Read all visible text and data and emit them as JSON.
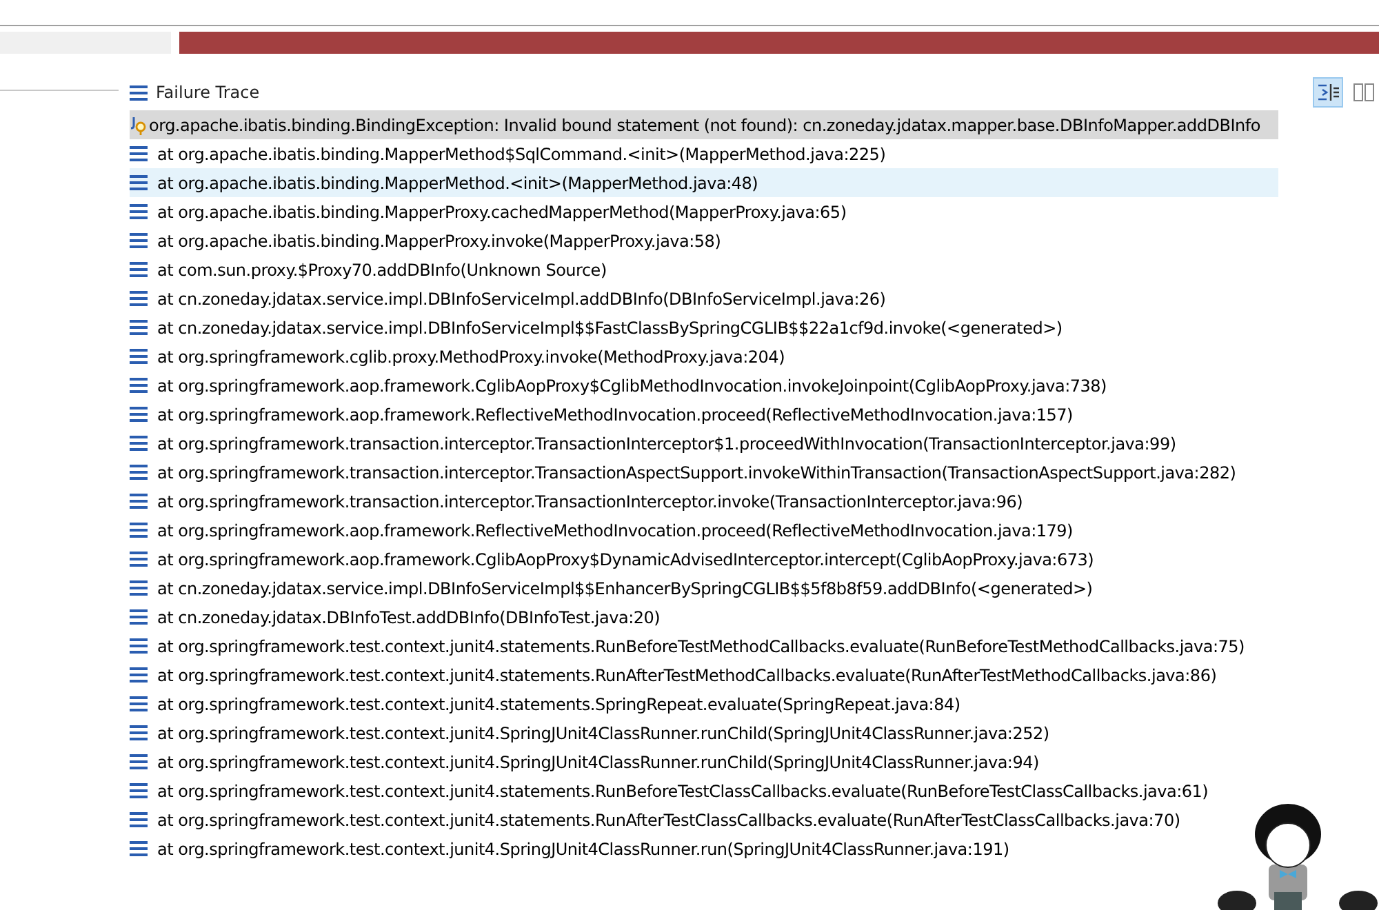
{
  "panel": {
    "title": "Failure Trace",
    "progress": {
      "level": 1,
      "failed": true
    }
  },
  "toolbar": [
    {
      "kind": "filter",
      "selected": true
    },
    {
      "kind": "compare",
      "selected": false
    }
  ],
  "trace": [
    {
      "kind": "exception",
      "text": "org.apache.ibatis.binding.BindingException: Invalid bound statement (not found): cn.zoneday.jdatax.mapper.base.DBInfoMapper.addDBInfo",
      "selected": true,
      "hovered": false
    },
    {
      "kind": "frame",
      "text": "at org.apache.ibatis.binding.MapperMethod$SqlCommand.<init>(MapperMethod.java:225)",
      "selected": false,
      "hovered": false
    },
    {
      "kind": "frame",
      "text": "at org.apache.ibatis.binding.MapperMethod.<init>(MapperMethod.java:48)",
      "selected": false,
      "hovered": true
    },
    {
      "kind": "frame",
      "text": "at org.apache.ibatis.binding.MapperProxy.cachedMapperMethod(MapperProxy.java:65)",
      "selected": false,
      "hovered": false
    },
    {
      "kind": "frame",
      "text": "at org.apache.ibatis.binding.MapperProxy.invoke(MapperProxy.java:58)",
      "selected": false,
      "hovered": false
    },
    {
      "kind": "frame",
      "text": "at com.sun.proxy.$Proxy70.addDBInfo(Unknown Source)",
      "selected": false,
      "hovered": false
    },
    {
      "kind": "frame",
      "text": "at cn.zoneday.jdatax.service.impl.DBInfoServiceImpl.addDBInfo(DBInfoServiceImpl.java:26)",
      "selected": false,
      "hovered": false
    },
    {
      "kind": "frame",
      "text": "at cn.zoneday.jdatax.service.impl.DBInfoServiceImpl$$FastClassBySpringCGLIB$$22a1cf9d.invoke(<generated>)",
      "selected": false,
      "hovered": false
    },
    {
      "kind": "frame",
      "text": "at org.springframework.cglib.proxy.MethodProxy.invoke(MethodProxy.java:204)",
      "selected": false,
      "hovered": false
    },
    {
      "kind": "frame",
      "text": "at org.springframework.aop.framework.CglibAopProxy$CglibMethodInvocation.invokeJoinpoint(CglibAopProxy.java:738)",
      "selected": false,
      "hovered": false
    },
    {
      "kind": "frame",
      "text": "at org.springframework.aop.framework.ReflectiveMethodInvocation.proceed(ReflectiveMethodInvocation.java:157)",
      "selected": false,
      "hovered": false
    },
    {
      "kind": "frame",
      "text": "at org.springframework.transaction.interceptor.TransactionInterceptor$1.proceedWithInvocation(TransactionInterceptor.java:99)",
      "selected": false,
      "hovered": false
    },
    {
      "kind": "frame",
      "text": "at org.springframework.transaction.interceptor.TransactionAspectSupport.invokeWithinTransaction(TransactionAspectSupport.java:282)",
      "selected": false,
      "hovered": false
    },
    {
      "kind": "frame",
      "text": "at org.springframework.transaction.interceptor.TransactionInterceptor.invoke(TransactionInterceptor.java:96)",
      "selected": false,
      "hovered": false
    },
    {
      "kind": "frame",
      "text": "at org.springframework.aop.framework.ReflectiveMethodInvocation.proceed(ReflectiveMethodInvocation.java:179)",
      "selected": false,
      "hovered": false
    },
    {
      "kind": "frame",
      "text": "at org.springframework.aop.framework.CglibAopProxy$DynamicAdvisedInterceptor.intercept(CglibAopProxy.java:673)",
      "selected": false,
      "hovered": false
    },
    {
      "kind": "frame",
      "text": "at cn.zoneday.jdatax.service.impl.DBInfoServiceImpl$$EnhancerBySpringCGLIB$$5f8b8f59.addDBInfo(<generated>)",
      "selected": false,
      "hovered": false
    },
    {
      "kind": "frame",
      "text": "at cn.zoneday.jdatax.DBInfoTest.addDBInfo(DBInfoTest.java:20)",
      "selected": false,
      "hovered": false
    },
    {
      "kind": "frame",
      "text": "at org.springframework.test.context.junit4.statements.RunBeforeTestMethodCallbacks.evaluate(RunBeforeTestMethodCallbacks.java:75)",
      "selected": false,
      "hovered": false
    },
    {
      "kind": "frame",
      "text": "at org.springframework.test.context.junit4.statements.RunAfterTestMethodCallbacks.evaluate(RunAfterTestMethodCallbacks.java:86)",
      "selected": false,
      "hovered": false
    },
    {
      "kind": "frame",
      "text": "at org.springframework.test.context.junit4.statements.SpringRepeat.evaluate(SpringRepeat.java:84)",
      "selected": false,
      "hovered": false
    },
    {
      "kind": "frame",
      "text": "at org.springframework.test.context.junit4.SpringJUnit4ClassRunner.runChild(SpringJUnit4ClassRunner.java:252)",
      "selected": false,
      "hovered": false
    },
    {
      "kind": "frame",
      "text": "at org.springframework.test.context.junit4.SpringJUnit4ClassRunner.runChild(SpringJUnit4ClassRunner.java:94)",
      "selected": false,
      "hovered": false
    },
    {
      "kind": "frame",
      "text": "at org.springframework.test.context.junit4.statements.RunBeforeTestClassCallbacks.evaluate(RunBeforeTestClassCallbacks.java:61)",
      "selected": false,
      "hovered": false
    },
    {
      "kind": "frame",
      "text": "at org.springframework.test.context.junit4.statements.RunAfterTestClassCallbacks.evaluate(RunAfterTestClassCallbacks.java:70)",
      "selected": false,
      "hovered": false
    },
    {
      "kind": "frame",
      "text": "at org.springframework.test.context.junit4.SpringJUnit4ClassRunner.run(SpringJUnit4ClassRunner.java:191)",
      "selected": false,
      "hovered": false
    }
  ]
}
